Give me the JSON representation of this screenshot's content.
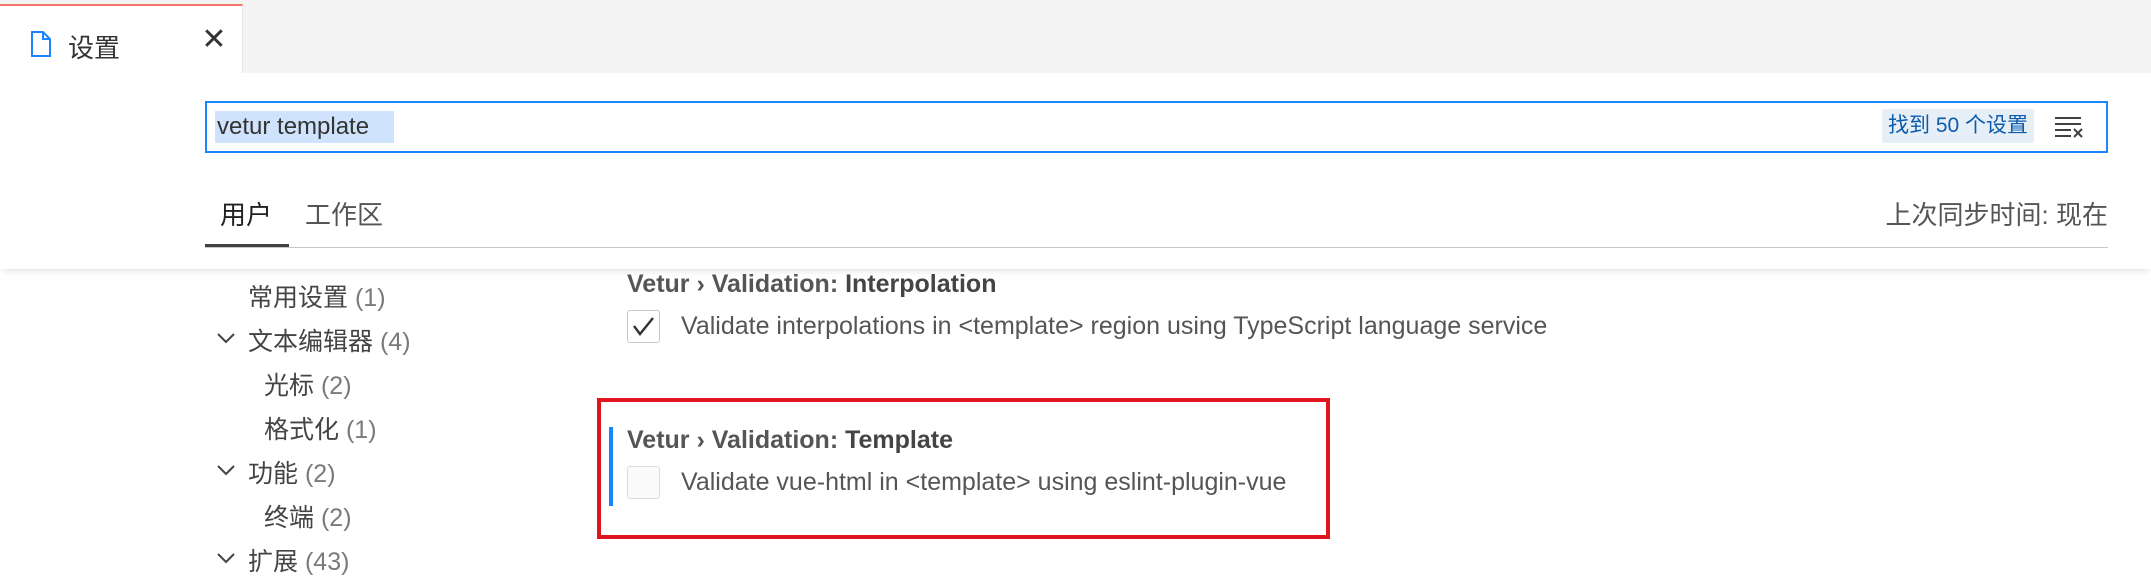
{
  "tab": {
    "title": "设置",
    "close_glyph": "✕",
    "icon": "file-icon"
  },
  "search": {
    "value": "vetur template",
    "result_count": "找到 50 个设置",
    "clear_icon": "clear-filter-icon"
  },
  "scope_tabs": {
    "user": "用户",
    "workspace": "工作区",
    "sync_status": "上次同步时间: 现在"
  },
  "toc": {
    "items": [
      {
        "label": "常用设置",
        "count": "(1)"
      },
      {
        "label": "文本编辑器",
        "count": "(4)",
        "expanded": true
      },
      {
        "label": "光标",
        "count": "(2)"
      },
      {
        "label": "格式化",
        "count": "(1)"
      },
      {
        "label": "功能",
        "count": "(2)",
        "expanded": true
      },
      {
        "label": "终端",
        "count": "(2)"
      },
      {
        "label": "扩展",
        "count": "(43)",
        "expanded": true
      }
    ]
  },
  "settings": [
    {
      "category": "Vetur › Validation: ",
      "name": "Interpolation",
      "description": "Validate interpolations in <template> region using TypeScript language service",
      "checked": true
    },
    {
      "category": "Vetur › Validation: ",
      "name": "Template",
      "description": "Validate vue-html in <template> using eslint-plugin-vue",
      "checked": false
    }
  ],
  "colors": {
    "accent": "#1a85ff",
    "highlight_box": "#e0141e",
    "tab_top_border": "#f2766c"
  }
}
